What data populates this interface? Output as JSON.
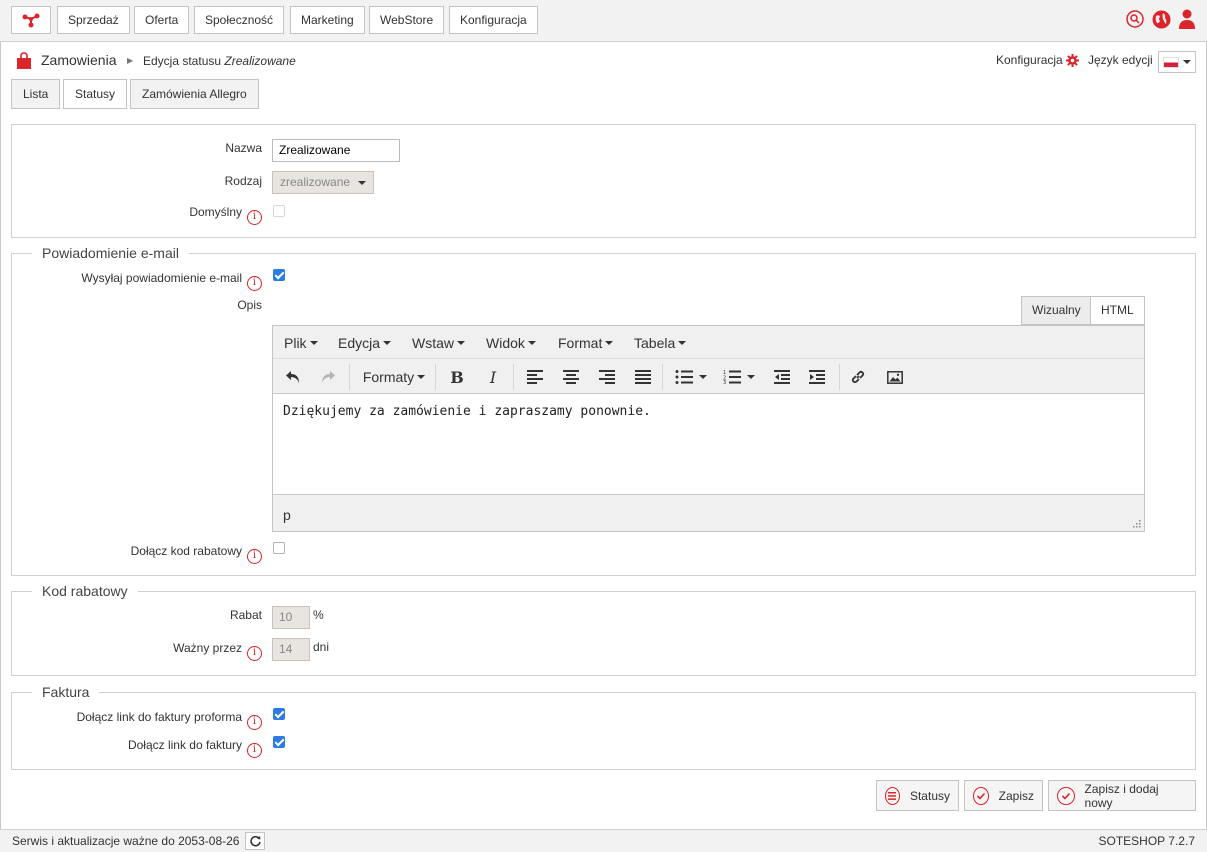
{
  "nav": {
    "logo_icon": "share-nodes-icon",
    "items": [
      "Sprzedaż",
      "Oferta",
      "Społeczność",
      "Marketing",
      "WebStore",
      "Konfiguracja"
    ],
    "right_icons": [
      "search-icon",
      "globe-icon",
      "user-icon"
    ],
    "accent_color": "#d9252b"
  },
  "header": {
    "module_title": "Zamowienia",
    "breadcrumb_prefix": "Edycja statusu",
    "breadcrumb_status": "Zrealizowane",
    "config_link": "Konfiguracja",
    "language_label": "Język edycji",
    "language_flag": "pl-flag"
  },
  "tabs": [
    "Lista",
    "Statusy",
    "Zamówienia Allegro"
  ],
  "form": {
    "name_label": "Nazwa",
    "name_value": "Zrealizowane",
    "type_label": "Rodzaj",
    "type_value": "zrealizowane",
    "default_label": "Domyślny"
  },
  "email": {
    "legend": "Powiadomienie e-mail",
    "send_label": "Wysyłaj powiadomienie e-mail",
    "desc_label": "Opis",
    "editor_tabs": [
      "Wizualny",
      "HTML"
    ],
    "menu": [
      "Plik",
      "Edycja",
      "Wstaw",
      "Widok",
      "Format",
      "Tabela"
    ],
    "formats_label": "Formaty",
    "content": "Dziękujemy za zamówienie i zapraszamy ponownie.",
    "path": "p",
    "attach_code_label": "Dołącz kod rabatowy"
  },
  "discount": {
    "legend": "Kod rabatowy",
    "rate_label": "Rabat",
    "rate_value": "10",
    "rate_unit": "%",
    "valid_label": "Ważny przez",
    "valid_value": "14",
    "valid_unit": "dni"
  },
  "invoice": {
    "legend": "Faktura",
    "proforma_label": "Dołącz link do faktury proforma",
    "invoice_label": "Dołącz link do faktury"
  },
  "actions": {
    "statuses": "Statusy",
    "save": "Zapisz",
    "save_new": "Zapisz i dodaj nowy"
  },
  "footer": {
    "service_text": "Serwis i aktualizacje ważne do 2053-08-26",
    "version": "SOTESHOP 7.2.7"
  }
}
